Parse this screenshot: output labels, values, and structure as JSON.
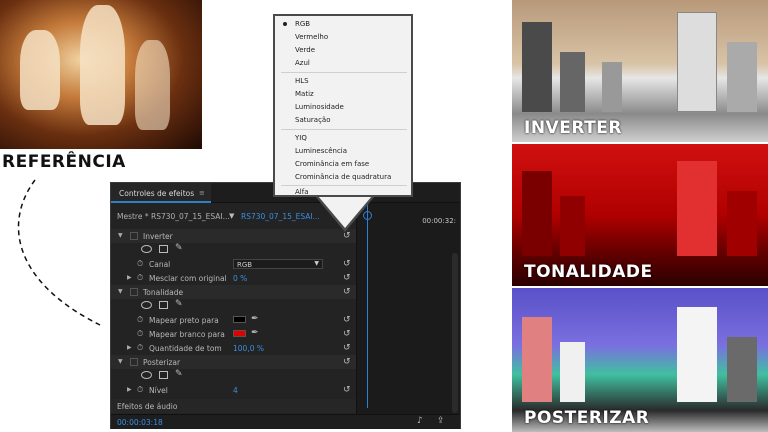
{
  "reference": {
    "label": "REFERÊNCIA"
  },
  "panel": {
    "tab_title": "Controles de efeitos",
    "master_text": "Mestre * RS730_07_15_ESAI...",
    "clip_text": "RS730_07_15_ESAI...",
    "timecode_top": "00:00:32:",
    "timecode_bottom": "00:00:03:18",
    "audio_section": "Efeitos de áudio",
    "effects": {
      "inverter": {
        "name": "Inverter",
        "canal_label": "Canal",
        "canal_value": "RGB",
        "mix_label": "Mesclar com original",
        "mix_value": "0 %"
      },
      "tonalidade": {
        "name": "Tonalidade",
        "black_label": "Mapear preto para",
        "white_label": "Mapear branco para",
        "amount_label": "Quantidade de tom",
        "amount_value": "100,0 %",
        "black_color": "#000000",
        "white_color": "#e00000"
      },
      "posterizar": {
        "name": "Posterizar",
        "level_label": "Nível",
        "level_value": "4"
      }
    }
  },
  "menu": {
    "items": [
      "RGB",
      "Vermelho",
      "Verde",
      "Azul",
      "HLS",
      "Matiz",
      "Luminosidade",
      "Saturação",
      "YIQ",
      "Luminescência",
      "Crominância em fase",
      "Crominância de quadratura",
      "Alfa"
    ],
    "selected": "RGB"
  },
  "shots": {
    "inverter": "INVERTER",
    "tonalidade": "TONALIDADE",
    "posterizar": "POSTERIZAR"
  },
  "colors": {
    "accent": "#2f80c9",
    "panel_bg": "#232323"
  }
}
